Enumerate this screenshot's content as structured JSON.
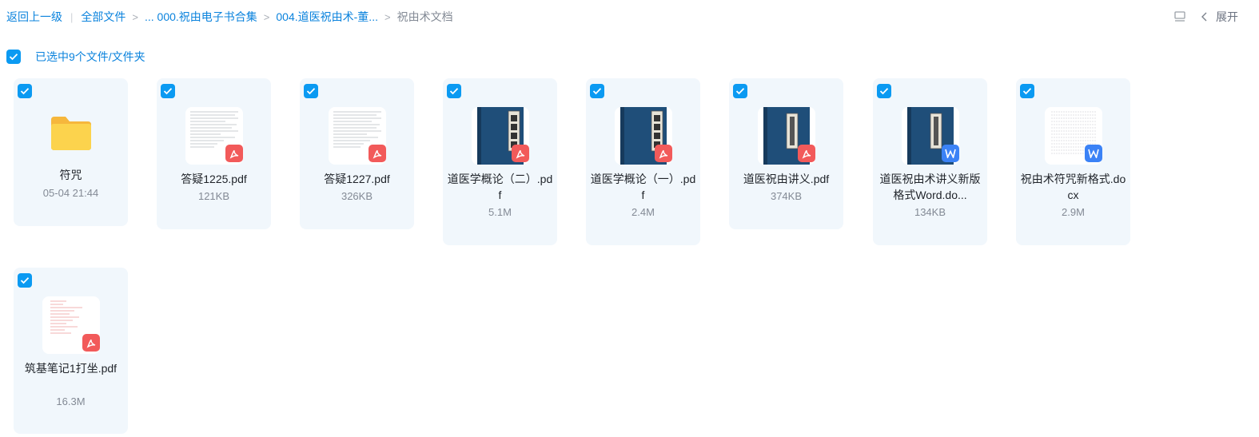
{
  "breadcrumb": {
    "back": "返回上一级",
    "all_files": "全部文件",
    "level1": "... 000.祝由电子书合集",
    "level2": "004.道医祝由术-董...",
    "current": "祝由术文档",
    "sep": ">",
    "divider": "|"
  },
  "toolbar": {
    "view_icon": "list-view-icon",
    "expand_label": "展开"
  },
  "selection": {
    "text": "已选中9个文件/文件夹"
  },
  "colors": {
    "accent": "#0b9af2",
    "link": "#0b83dd",
    "card_bg": "#f1f7fc",
    "pdf_badge": "#f25a5a",
    "word_badge": "#3b82f6",
    "book_cover": "#1f4e79"
  },
  "files": [
    {
      "name": "符咒",
      "meta": "05-04 21:44",
      "kind": "folder"
    },
    {
      "name": "答疑1225.pdf",
      "meta": "121KB",
      "kind": "pdf"
    },
    {
      "name": "答疑1227.pdf",
      "meta": "326KB",
      "kind": "pdf"
    },
    {
      "name": "道医学概论（二）.pdf",
      "meta": "5.1M",
      "kind": "pdf"
    },
    {
      "name": "道医学概论（一）.pdf",
      "meta": "2.4M",
      "kind": "pdf"
    },
    {
      "name": "道医祝由讲义.pdf",
      "meta": "374KB",
      "kind": "pdf"
    },
    {
      "name": "道医祝由术讲义新版格式Word.do...",
      "meta": "134KB",
      "kind": "word"
    },
    {
      "name": "祝由术符咒新格式.docx",
      "meta": "2.9M",
      "kind": "word"
    },
    {
      "name": "筑基笔记1打坐.pdf",
      "meta": "16.3M",
      "kind": "pdf"
    }
  ]
}
